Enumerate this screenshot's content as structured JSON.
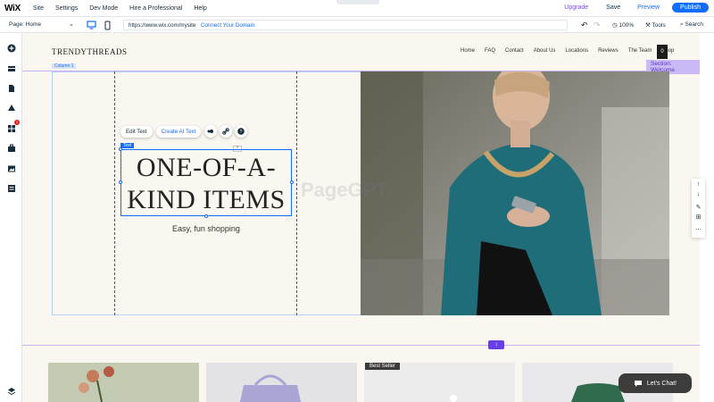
{
  "editor": {
    "logo": "WiX",
    "menu": [
      "Site",
      "Settings",
      "Dev Mode",
      "Hire a Professional",
      "Help"
    ],
    "upgrade": "Upgrade",
    "save": "Save",
    "preview": "Preview",
    "publish": "Publish",
    "page": "Page: Home",
    "url": "https://www.wix.com/mysite",
    "connect_domain": "Connect Your Domain",
    "zoom": "100%",
    "tools": "Tools",
    "search": "Search",
    "notification_count": "1"
  },
  "site": {
    "brand": "TRENDYTHREADS",
    "nav": [
      "Home",
      "FAQ",
      "Contact",
      "About Us",
      "Locations",
      "Reviews",
      "The Team",
      "Shop"
    ],
    "cart_count": "0",
    "column_label": "Column 1",
    "section_label": "Section: Welcome",
    "text_label": "Text",
    "hero_title": "ONE-OF-A-KIND ITEMS",
    "hero_subtitle": "Easy, fun shopping",
    "best_seller": "Best Seller",
    "chat": "Let's Chat!"
  },
  "text_toolbar": {
    "edit_text": "Edit Text",
    "create_ai_text": "Create AI Text"
  },
  "watermark": "PageGPT",
  "colors": {
    "accent": "#116dff",
    "section": "#6a3ee6",
    "canvas": "#f9f7ef"
  }
}
